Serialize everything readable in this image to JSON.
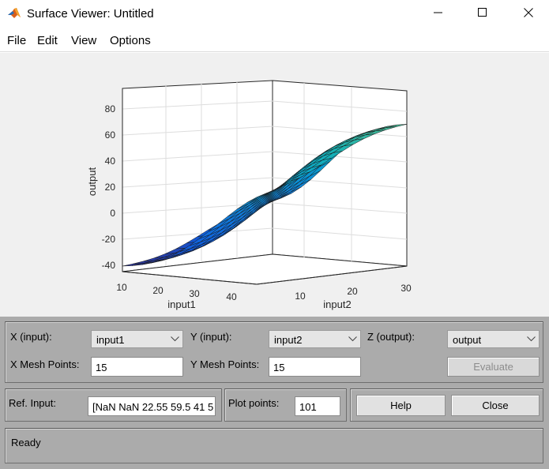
{
  "window": {
    "title": "Surface Viewer: Untitled",
    "icon": "matlab-icon",
    "controls": [
      "minimize-icon",
      "maximize-icon",
      "close-icon"
    ]
  },
  "menu": {
    "items": [
      "File",
      "Edit",
      "View",
      "Options"
    ]
  },
  "plot": {
    "type": "3d-surface",
    "colormap": "parula",
    "zlabel": "output",
    "xlabel": "input1",
    "ylabel": "input2",
    "z_ticks": [
      "80",
      "60",
      "40",
      "20",
      "0",
      "-20",
      "-40"
    ],
    "x_ticks": [
      "10",
      "20",
      "30",
      "40"
    ],
    "y_ticks": [
      "10",
      "20",
      "30"
    ],
    "x_range": [
      10,
      40
    ],
    "y_range": [
      5,
      30
    ],
    "z_range": [
      -45,
      95
    ],
    "mesh": 15
  },
  "controls": {
    "x_input_label": "X (input):",
    "x_input_value": "input1",
    "y_input_label": "Y (input):",
    "y_input_value": "input2",
    "z_output_label": "Z (output):",
    "z_output_value": "output",
    "x_mesh_label": "X Mesh Points:",
    "x_mesh_value": "15",
    "y_mesh_label": "Y Mesh Points:",
    "y_mesh_value": "15",
    "evaluate_label": "Evaluate",
    "ref_input_label": "Ref. Input:",
    "ref_input_value": "[NaN NaN 22.55 59.5 41 5",
    "plot_points_label": "Plot points:",
    "plot_points_value": "101",
    "help_label": "Help",
    "close_label": "Close",
    "status": "Ready"
  },
  "colors": {
    "panel_bg": "#ababab",
    "plot_bg": "#f0f0f0"
  }
}
